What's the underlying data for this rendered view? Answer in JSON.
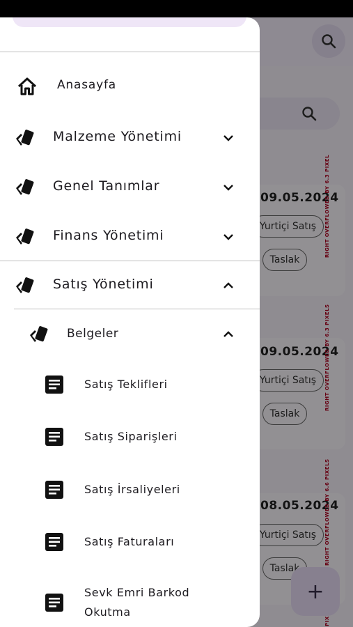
{
  "background": {
    "cards": [
      {
        "date": "09.05.2024",
        "type_chip": "Yurtiçi Satış",
        "status_chip": "Taslak",
        "overflow_warning": "RIGHT OVERFLOWED BY 6.3 PIXEL"
      },
      {
        "date": "09.05.2024",
        "type_chip": "Yurtiçi Satış",
        "status_chip": "Taslak",
        "overflow_warning": "RIGHT OVERFLOWED BY 6.3 PIXELS"
      },
      {
        "date": "08.05.2024",
        "type_chip": "Yurtiçi Satış",
        "status_chip": "Taslak",
        "overflow_warning": "RIGHT OVERFLOWED BY 6.6 PIXELS"
      }
    ],
    "bottom_overflow_fragment": "PIX",
    "fab_symbol": "+"
  },
  "drawer": {
    "home": {
      "label": "Anasayfa"
    },
    "sections": [
      {
        "label": "Malzeme Yönetimi"
      },
      {
        "label": "Genel Tanımlar"
      },
      {
        "label": "Finans Yönetimi"
      },
      {
        "label": "Satış Yönetimi"
      }
    ],
    "subsection": {
      "label": "Belgeler"
    },
    "leaves": [
      {
        "label": "Satış Teklifleri"
      },
      {
        "label": "Satış Siparişleri"
      },
      {
        "label": "Satış İrsaliyeleri"
      },
      {
        "label": "Satış Faturaları"
      },
      {
        "label": "Sevk Emri Barkod Okutma"
      }
    ]
  }
}
